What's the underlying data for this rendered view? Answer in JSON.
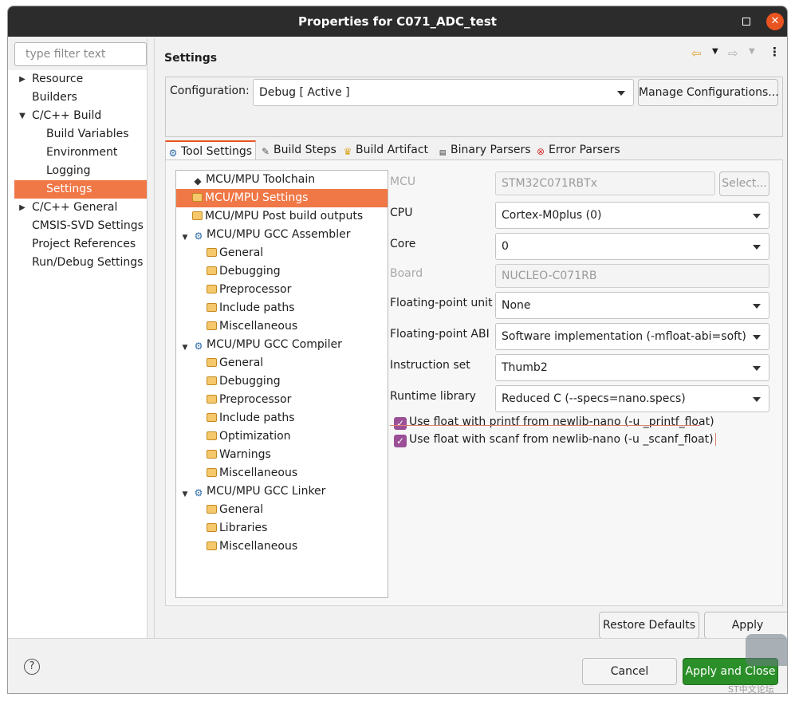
{
  "window": {
    "title": "Properties for C071_ADC_test",
    "close_glyph": "✕"
  },
  "filter": {
    "placeholder": "type filter text"
  },
  "nav": [
    {
      "label": "Resource",
      "arrow": "▶"
    },
    {
      "label": "Builders",
      "arrow": ""
    },
    {
      "label": "C/C++ Build",
      "arrow": "▼"
    },
    {
      "label": "Build Variables",
      "arrow": ""
    },
    {
      "label": "Environment",
      "arrow": ""
    },
    {
      "label": "Logging",
      "arrow": ""
    },
    {
      "label": "Settings",
      "arrow": "",
      "selected": true
    },
    {
      "label": "C/C++ General",
      "arrow": "▶"
    },
    {
      "label": "CMSIS-SVD Settings",
      "arrow": ""
    },
    {
      "label": "Project References",
      "arrow": ""
    },
    {
      "label": "Run/Debug Settings",
      "arrow": ""
    }
  ],
  "settings": {
    "title": "Settings",
    "configuration_label": "Configuration:",
    "configuration_value": "Debug  [ Active ]",
    "manage_button": "Manage Configurations..."
  },
  "tabs": [
    {
      "label": "Tool Settings",
      "icon": "gear-icon",
      "active": true
    },
    {
      "label": "Build Steps",
      "icon": "wrench-icon"
    },
    {
      "label": "Build Artifact",
      "icon": "trophy-icon"
    },
    {
      "label": "Binary Parsers",
      "icon": "binary-icon"
    },
    {
      "label": "Error Parsers",
      "icon": "error-icon"
    }
  ],
  "tree": [
    {
      "label": "MCU/MPU Toolchain",
      "icon": "chip",
      "indent": 1
    },
    {
      "label": "MCU/MPU Settings",
      "icon": "folder",
      "indent": 1,
      "selected": true
    },
    {
      "label": "MCU/MPU Post build outputs",
      "icon": "folder",
      "indent": 1
    },
    {
      "label": "MCU/MPU GCC Assembler",
      "icon": "gear",
      "indent": 0,
      "expanded": true
    },
    {
      "label": "General",
      "icon": "folder",
      "indent": 2
    },
    {
      "label": "Debugging",
      "icon": "folder",
      "indent": 2
    },
    {
      "label": "Preprocessor",
      "icon": "folder",
      "indent": 2
    },
    {
      "label": "Include paths",
      "icon": "folder",
      "indent": 2
    },
    {
      "label": "Miscellaneous",
      "icon": "folder",
      "indent": 2
    },
    {
      "label": "MCU/MPU GCC Compiler",
      "icon": "gear",
      "indent": 0,
      "expanded": true
    },
    {
      "label": "General",
      "icon": "folder",
      "indent": 2
    },
    {
      "label": "Debugging",
      "icon": "folder",
      "indent": 2
    },
    {
      "label": "Preprocessor",
      "icon": "folder",
      "indent": 2
    },
    {
      "label": "Include paths",
      "icon": "folder",
      "indent": 2
    },
    {
      "label": "Optimization",
      "icon": "folder",
      "indent": 2
    },
    {
      "label": "Warnings",
      "icon": "folder",
      "indent": 2
    },
    {
      "label": "Miscellaneous",
      "icon": "folder",
      "indent": 2
    },
    {
      "label": "MCU/MPU GCC Linker",
      "icon": "gear",
      "indent": 0,
      "expanded": true
    },
    {
      "label": "General",
      "icon": "folder",
      "indent": 2
    },
    {
      "label": "Libraries",
      "icon": "folder",
      "indent": 2
    },
    {
      "label": "Miscellaneous",
      "icon": "folder",
      "indent": 2
    }
  ],
  "fields": {
    "mcu": {
      "label": "MCU",
      "value": "STM32C071RBTx",
      "select_button": "Select..."
    },
    "cpu": {
      "label": "CPU",
      "value": "Cortex-M0plus (0)"
    },
    "core": {
      "label": "Core",
      "value": "0"
    },
    "board": {
      "label": "Board",
      "value": "NUCLEO-C071RB"
    },
    "fpu": {
      "label": "Floating-point unit",
      "value": "None"
    },
    "fpabi": {
      "label": "Floating-point ABI",
      "value": "Software implementation (-mfloat-abi=soft)"
    },
    "iset": {
      "label": "Instruction set",
      "value": "Thumb2"
    },
    "rtlib": {
      "label": "Runtime library",
      "value": "Reduced C (--specs=nano.specs)"
    },
    "printf_float": {
      "label": "Use float with printf from newlib-nano (-u _printf_float)",
      "checked": true
    },
    "scanf_float": {
      "label": "Use float with scanf from newlib-nano (-u _scanf_float)",
      "checked": true
    }
  },
  "buttons": {
    "restore_defaults": "Restore Defaults",
    "apply": "Apply",
    "cancel": "Cancel",
    "apply_close": "Apply and Close",
    "help": "?"
  },
  "watermark": "ST中文论坛",
  "colors": {
    "accent": "#e95420",
    "selection": "#f07746",
    "checkbox": "#9b4f96",
    "primary_button": "#2b8f29"
  }
}
